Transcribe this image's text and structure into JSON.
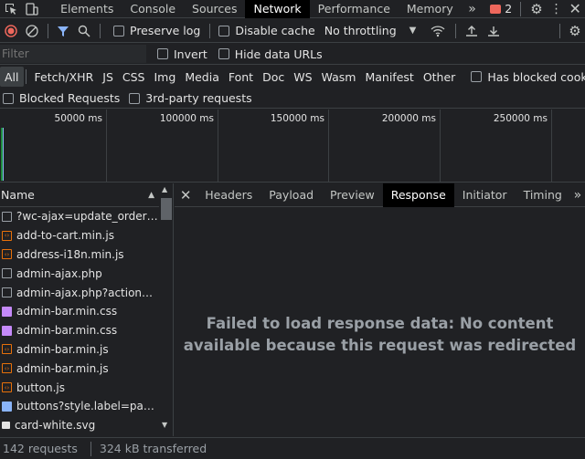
{
  "tabs": [
    "Elements",
    "Console",
    "Sources",
    "Network",
    "Performance",
    "Memory"
  ],
  "active_tab": "Network",
  "issues_count": "2",
  "toolbar": {
    "preserve_log": "Preserve log",
    "disable_cache": "Disable cache",
    "throttling": "No throttling"
  },
  "filter": {
    "placeholder": "Filter",
    "invert": "Invert",
    "hide_data_urls": "Hide data URLs"
  },
  "types": [
    "All",
    "Fetch/XHR",
    "JS",
    "CSS",
    "Img",
    "Media",
    "Font",
    "Doc",
    "WS",
    "Wasm",
    "Manifest",
    "Other"
  ],
  "has_blocked_cookies": "Has blocked cookies",
  "blocked_requests": "Blocked Requests",
  "third_party": "3rd-party requests",
  "overview_ticks": [
    "50000 ms",
    "100000 ms",
    "150000 ms",
    "200000 ms",
    "250000 ms"
  ],
  "list": {
    "header": "Name",
    "requests": [
      {
        "name": "?wc-ajax=update_order_rev...",
        "type": "doc"
      },
      {
        "name": "add-to-cart.min.js",
        "type": "js"
      },
      {
        "name": "address-i18n.min.js",
        "type": "js"
      },
      {
        "name": "admin-ajax.php",
        "type": "doc"
      },
      {
        "name": "admin-ajax.php?action=ima...",
        "type": "doc"
      },
      {
        "name": "admin-bar.min.css",
        "type": "css"
      },
      {
        "name": "admin-bar.min.css",
        "type": "css"
      },
      {
        "name": "admin-bar.min.js",
        "type": "js"
      },
      {
        "name": "admin-bar.min.js",
        "type": "js"
      },
      {
        "name": "button.js",
        "type": "js"
      },
      {
        "name": "buttons?style.label=paypal...",
        "type": "txt"
      },
      {
        "name": "card-white.svg",
        "type": "img"
      }
    ]
  },
  "detail": {
    "tabs": [
      "Headers",
      "Payload",
      "Preview",
      "Response",
      "Initiator",
      "Timing"
    ],
    "active": "Response",
    "message_line1": "Failed to load response data: No content",
    "message_line2": "available because this request was redirected"
  },
  "status": {
    "requests": "142 requests",
    "transferred": "324 kB transferred"
  }
}
